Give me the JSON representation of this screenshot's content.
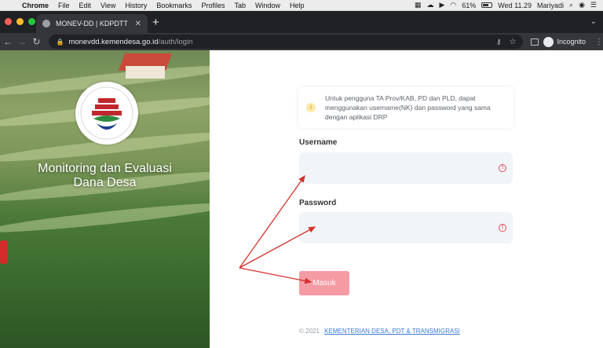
{
  "menubar": {
    "app": "Chrome",
    "items": [
      "File",
      "Edit",
      "View",
      "History",
      "Bookmarks",
      "Profiles",
      "Tab",
      "Window",
      "Help"
    ],
    "battery": "61%",
    "datetime": "Wed 11.29",
    "user": "Mariyadi"
  },
  "browser": {
    "tab_title": "MONEV-DD | KDPDTT",
    "url_host": "monevdd.kemendesa.go.id",
    "url_path": "/auth/login",
    "profile_label": "Incognito"
  },
  "hero": {
    "title_line1": "Monitoring dan Evaluasi",
    "title_line2": "Dana Desa"
  },
  "login": {
    "notice": "Untuk pengguna TA Prov/KAB, PD dan PLD, dapat menggunakan username(NK) dan password yang sama dengan aplikasi DRP",
    "username_label": "Username",
    "username_value": "",
    "password_label": "Password",
    "password_value": "",
    "submit_label": "Masuk",
    "footer_prefix": "© 2021",
    "footer_link": "KEMENTERIAN DESA, PDT & TRANSMIGRASI"
  },
  "colors": {
    "button": "#f59ba4",
    "field_bg": "#f1f5f8",
    "error_icon": "#e34b58",
    "annotation_arrow": "#d6312b"
  }
}
